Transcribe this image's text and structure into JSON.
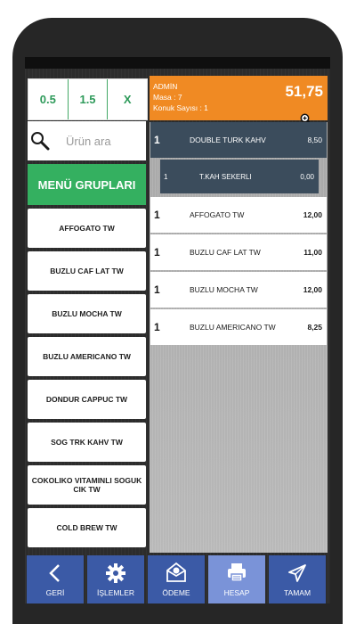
{
  "qty_buttons": [
    "0.5",
    "1.5",
    "X"
  ],
  "search": {
    "placeholder": "Ürün ara",
    "icon": "search-icon"
  },
  "menu_groups_label": "MENÜ GRUPLARI",
  "products": [
    "AFFOGATO TW",
    "BUZLU CAF LAT TW",
    "BUZLU MOCHA TW",
    "BUZLU AMERICANO TW",
    "DONDUR CAPPUC TW",
    "SOG TRK KAHV TW",
    "COKOLIKO VITAMINLI SOGUK CIK TW",
    "COLD BREW TW"
  ],
  "header": {
    "user": "ADMİN",
    "table": "Masa : 7",
    "guests": "Konuk Sayısı : 1",
    "total": "51,75"
  },
  "order_lines": [
    {
      "qty": "1",
      "name": "DOUBLE TURK KAHV",
      "price": "8,50"
    },
    {
      "qty": "1",
      "name": "AFFOGATO TW",
      "price": "12,00"
    },
    {
      "qty": "1",
      "name": "BUZLU CAF LAT TW",
      "price": "11,00"
    },
    {
      "qty": "1",
      "name": "BUZLU MOCHA TW",
      "price": "12,00"
    },
    {
      "qty": "1",
      "name": "BUZLU AMERICANO TW",
      "price": "8,25"
    }
  ],
  "sub_line": {
    "qty": "1",
    "name": "T.KAH SEKERLI",
    "price": "0,00"
  },
  "bottom_bar": [
    {
      "label": "GERİ",
      "icon": "chevron-left-icon"
    },
    {
      "label": "İŞLEMLER",
      "icon": "gear-icon"
    },
    {
      "label": "ÖDEME",
      "icon": "payment-icon"
    },
    {
      "label": "HESAP",
      "icon": "printer-icon"
    },
    {
      "label": "TAMAM",
      "icon": "send-icon"
    }
  ],
  "colors": {
    "accent_green": "#34b060",
    "header_orange": "#f08a23",
    "order_dark": "#3b4c5c",
    "bottom_blue": "#3b5aa6",
    "bottom_active": "#7a93d8"
  }
}
